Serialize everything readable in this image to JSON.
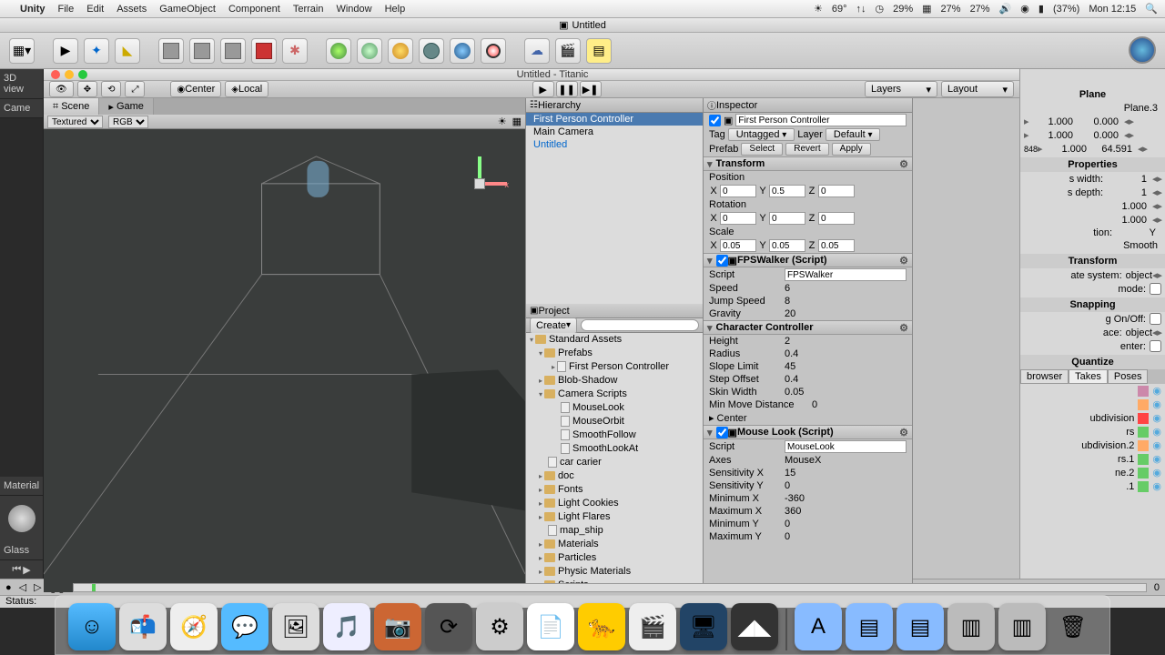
{
  "menubar": {
    "app": "Unity",
    "items": [
      "File",
      "Edit",
      "Assets",
      "GameObject",
      "Component",
      "Terrain",
      "Window",
      "Help"
    ],
    "temp": "69°",
    "pct1": "29%",
    "pct2": "27%",
    "pct3": "27%",
    "battery": "(37%)",
    "clock": "Mon 12:15"
  },
  "bg_doc_title": "Untitled",
  "unity_title": "Untitled - Titanic",
  "toolbar": {
    "center": "Center",
    "local": "Local",
    "layers": "Layers",
    "layout": "Layout"
  },
  "scene": {
    "tab_scene": "Scene",
    "tab_game": "Game",
    "textured": "Textured",
    "rgb": "RGB"
  },
  "hierarchy": {
    "title": "Hierarchy",
    "items": [
      "First Person Controller",
      "Main Camera",
      "Untitled"
    ]
  },
  "project": {
    "title": "Project",
    "create": "Create",
    "tree": [
      {
        "l": "Standard Assets",
        "d": 0,
        "open": true,
        "folder": true
      },
      {
        "l": "Prefabs",
        "d": 1,
        "open": true,
        "folder": true
      },
      {
        "l": "First Person Controller",
        "d": 2,
        "folder": false
      },
      {
        "l": "Blob-Shadow",
        "d": 1,
        "folder": true
      },
      {
        "l": "Camera Scripts",
        "d": 1,
        "open": true,
        "folder": true
      },
      {
        "l": "MouseLook",
        "d": 2,
        "folder": false,
        "leaf": true
      },
      {
        "l": "MouseOrbit",
        "d": 2,
        "folder": false,
        "leaf": true
      },
      {
        "l": "SmoothFollow",
        "d": 2,
        "folder": false,
        "leaf": true
      },
      {
        "l": "SmoothLookAt",
        "d": 2,
        "folder": false,
        "leaf": true
      },
      {
        "l": "car carier",
        "d": 1,
        "folder": false,
        "leaf": true
      },
      {
        "l": "doc",
        "d": 1,
        "folder": true
      },
      {
        "l": "Fonts",
        "d": 1,
        "folder": true
      },
      {
        "l": "Light Cookies",
        "d": 1,
        "folder": true
      },
      {
        "l": "Light Flares",
        "d": 1,
        "folder": true
      },
      {
        "l": "map_ship",
        "d": 1,
        "folder": false,
        "leaf": true
      },
      {
        "l": "Materials",
        "d": 1,
        "folder": true
      },
      {
        "l": "Particles",
        "d": 1,
        "folder": true
      },
      {
        "l": "Physic Materials",
        "d": 1,
        "folder": true
      },
      {
        "l": "Scripts",
        "d": 1,
        "folder": true
      }
    ]
  },
  "inspector": {
    "title": "Inspector",
    "name": "First Person Controller",
    "tag_lbl": "Tag",
    "tag": "Untagged",
    "layer_lbl": "Layer",
    "layer": "Default",
    "prefab_lbl": "Prefab",
    "select": "Select",
    "revert": "Revert",
    "apply": "Apply",
    "transform": {
      "title": "Transform",
      "pos_lbl": "Position",
      "rot_lbl": "Rotation",
      "scale_lbl": "Scale",
      "pos": {
        "x": "0",
        "y": "0.5",
        "z": "0"
      },
      "rot": {
        "x": "0",
        "y": "0",
        "z": "0"
      },
      "scale": {
        "x": "0.05",
        "y": "0.05",
        "z": "0.05"
      }
    },
    "fps": {
      "title": "FPSWalker (Script)",
      "script_lbl": "Script",
      "script": "FPSWalker",
      "speed_lbl": "Speed",
      "speed": "6",
      "jump_lbl": "Jump Speed",
      "jump": "8",
      "grav_lbl": "Gravity",
      "grav": "20"
    },
    "cc": {
      "title": "Character Controller",
      "height_lbl": "Height",
      "height": "2",
      "radius_lbl": "Radius",
      "radius": "0.4",
      "slope_lbl": "Slope Limit",
      "slope": "45",
      "step_lbl": "Step Offset",
      "step": "0.4",
      "skin_lbl": "Skin Width",
      "skin": "0.05",
      "min_lbl": "Min Move Distance",
      "min": "0",
      "center_lbl": "Center"
    },
    "ml": {
      "title": "Mouse Look (Script)",
      "script_lbl": "Script",
      "script": "MouseLook",
      "axes_lbl": "Axes",
      "axes": "MouseX",
      "sx_lbl": "Sensitivity X",
      "sx": "15",
      "sy_lbl": "Sensitivity Y",
      "sy": "0",
      "minx_lbl": "Minimum X",
      "minx": "-360",
      "maxx_lbl": "Maximum X",
      "maxx": "360",
      "miny_lbl": "Minimum Y",
      "miny": "0",
      "maxy_lbl": "Maximum Y",
      "maxy": "0"
    }
  },
  "bg_right": {
    "title": "Plane",
    "sub": "Plane.3",
    "rows": [
      {
        "v": "1.000"
      },
      {
        "v": "0.000"
      },
      {
        "v": "1.000"
      },
      {
        "v": "0.000"
      },
      {
        "v": "1.000"
      },
      {
        "v": "64.591"
      }
    ],
    "props": "Properties",
    "width": "s width:",
    "width_v": "1",
    "depth": "s depth:",
    "depth_v": "1",
    "d3": "1.000",
    "d4": "1.000",
    "ylabel": "Y",
    "smooth": "Smooth",
    "transform": "Transform",
    "ate": "ate system:",
    "ate_v": "object",
    "mode": "mode:",
    "snapping": "Snapping",
    "onoff": "g On/Off:",
    "ace": "ace:",
    "ace_v": "object",
    "enter": "enter:",
    "quant": "Quantize",
    "tab_browser": "browser",
    "tab_takes": "Takes",
    "tab_poses": "Poses",
    "list": [
      "",
      "",
      "ubdivision",
      "rs",
      "ubdivision.2",
      "rs.1",
      "ne.2",
      ".1"
    ]
  },
  "bottom": {
    "frame": "0"
  },
  "status": "Status:",
  "panel_left": {
    "view": "3D view",
    "camera": "Came",
    "material": "Material",
    "glass": "Glass"
  }
}
